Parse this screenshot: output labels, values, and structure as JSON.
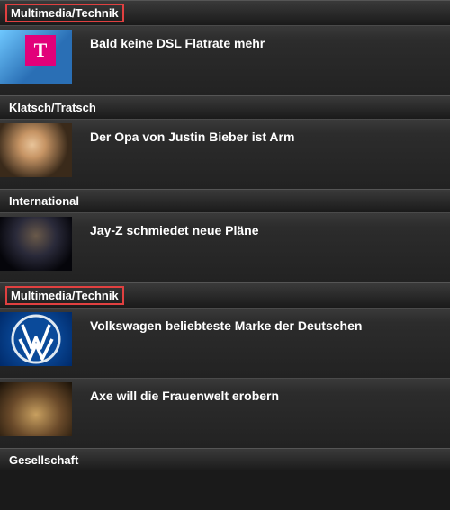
{
  "sections": [
    {
      "category": "Multimedia/Technik",
      "highlighted": true,
      "articles": [
        {
          "headline": "Bald keine DSL Flatrate mehr",
          "thumb": "telekom-logo"
        }
      ]
    },
    {
      "category": "Klatsch/Tratsch",
      "highlighted": false,
      "articles": [
        {
          "headline": "Der Opa von Justin Bieber ist Arm",
          "thumb": "justin-bieber"
        }
      ]
    },
    {
      "category": "International",
      "highlighted": false,
      "articles": [
        {
          "headline": "Jay-Z schmiedet neue Pläne",
          "thumb": "jay-z"
        }
      ]
    },
    {
      "category": "Multimedia/Technik",
      "highlighted": true,
      "articles": [
        {
          "headline": "Volkswagen beliebteste Marke der Deutschen",
          "thumb": "vw-logo"
        },
        {
          "headline": "Axe will die Frauenwelt erobern",
          "thumb": "axe-ad"
        }
      ]
    },
    {
      "category": "Gesellschaft",
      "highlighted": false,
      "articles": []
    }
  ]
}
